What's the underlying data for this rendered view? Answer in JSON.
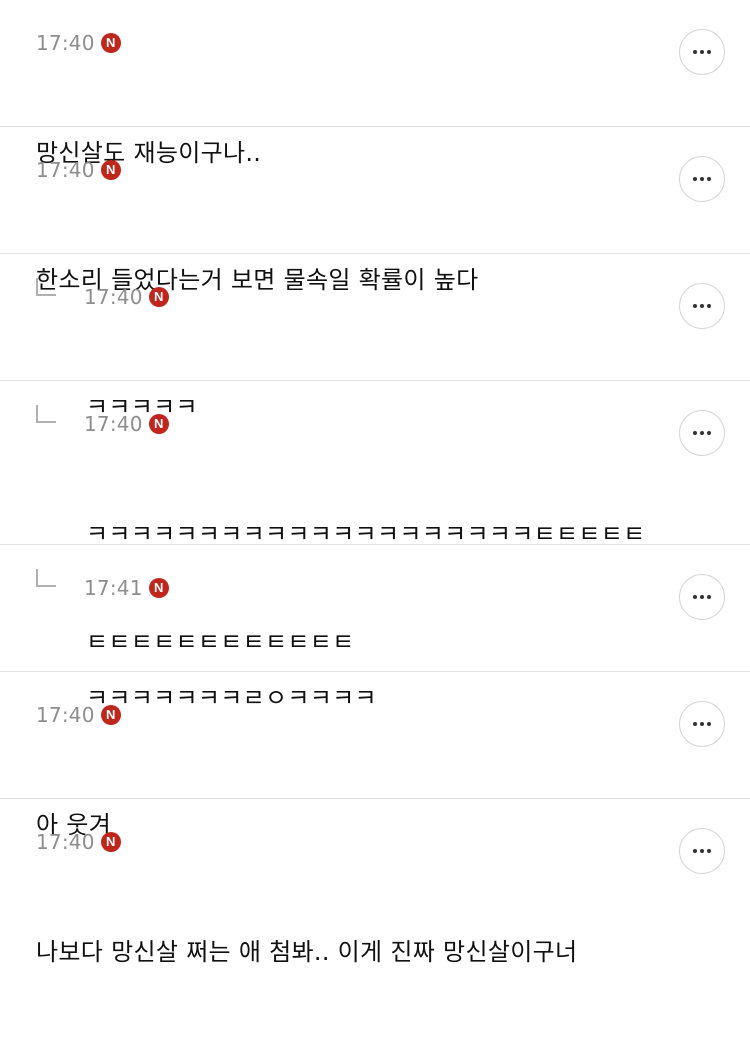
{
  "comments": [
    {
      "time": "17:40",
      "badge": "N",
      "is_reply": false,
      "lines": [
        "망신살도 재능이구나.."
      ]
    },
    {
      "time": "17:40",
      "badge": "N",
      "is_reply": false,
      "lines": [
        "한소리 들었다는거 보면 물속일 확률이 높다"
      ]
    },
    {
      "time": "17:40",
      "badge": "N",
      "is_reply": true,
      "lines": [
        "ㅋㅋㅋㅋㅋ"
      ]
    },
    {
      "time": "17:40",
      "badge": "N",
      "is_reply": true,
      "lines": [
        "ㅋㅋㅋㅋㅋㅋㅋㅋㅋㅋㅋㅋㅋㅋㅋㅋㅋㅋㅋㅋㅌㅌㅌㅌㅌ",
        "ㅌㅌㅌㅌㅌㅌㅌㅌㅌㅌㅌㅌ"
      ]
    },
    {
      "time": "17:41",
      "badge": "N",
      "is_reply": true,
      "lines": [
        "ㅋㅋㅋㅋㅋㅋㅋㄹㅇㅋㅋㅋㅋ"
      ]
    },
    {
      "time": "17:40",
      "badge": "N",
      "is_reply": false,
      "lines": [
        "아 웃겨"
      ]
    },
    {
      "time": "17:40",
      "badge": "N",
      "is_reply": false,
      "lines": [
        "나보다 망신살 쩌는 애 첨봐.. 이게 진짜 망신살이구너"
      ]
    }
  ],
  "colors": {
    "badge": "#c0261c",
    "time": "#8e8e8e",
    "divider": "#e4e4e4"
  },
  "icons": {
    "badge": "new-badge-icon",
    "reply": "reply-arrow-icon",
    "more": "more-options-icon"
  }
}
